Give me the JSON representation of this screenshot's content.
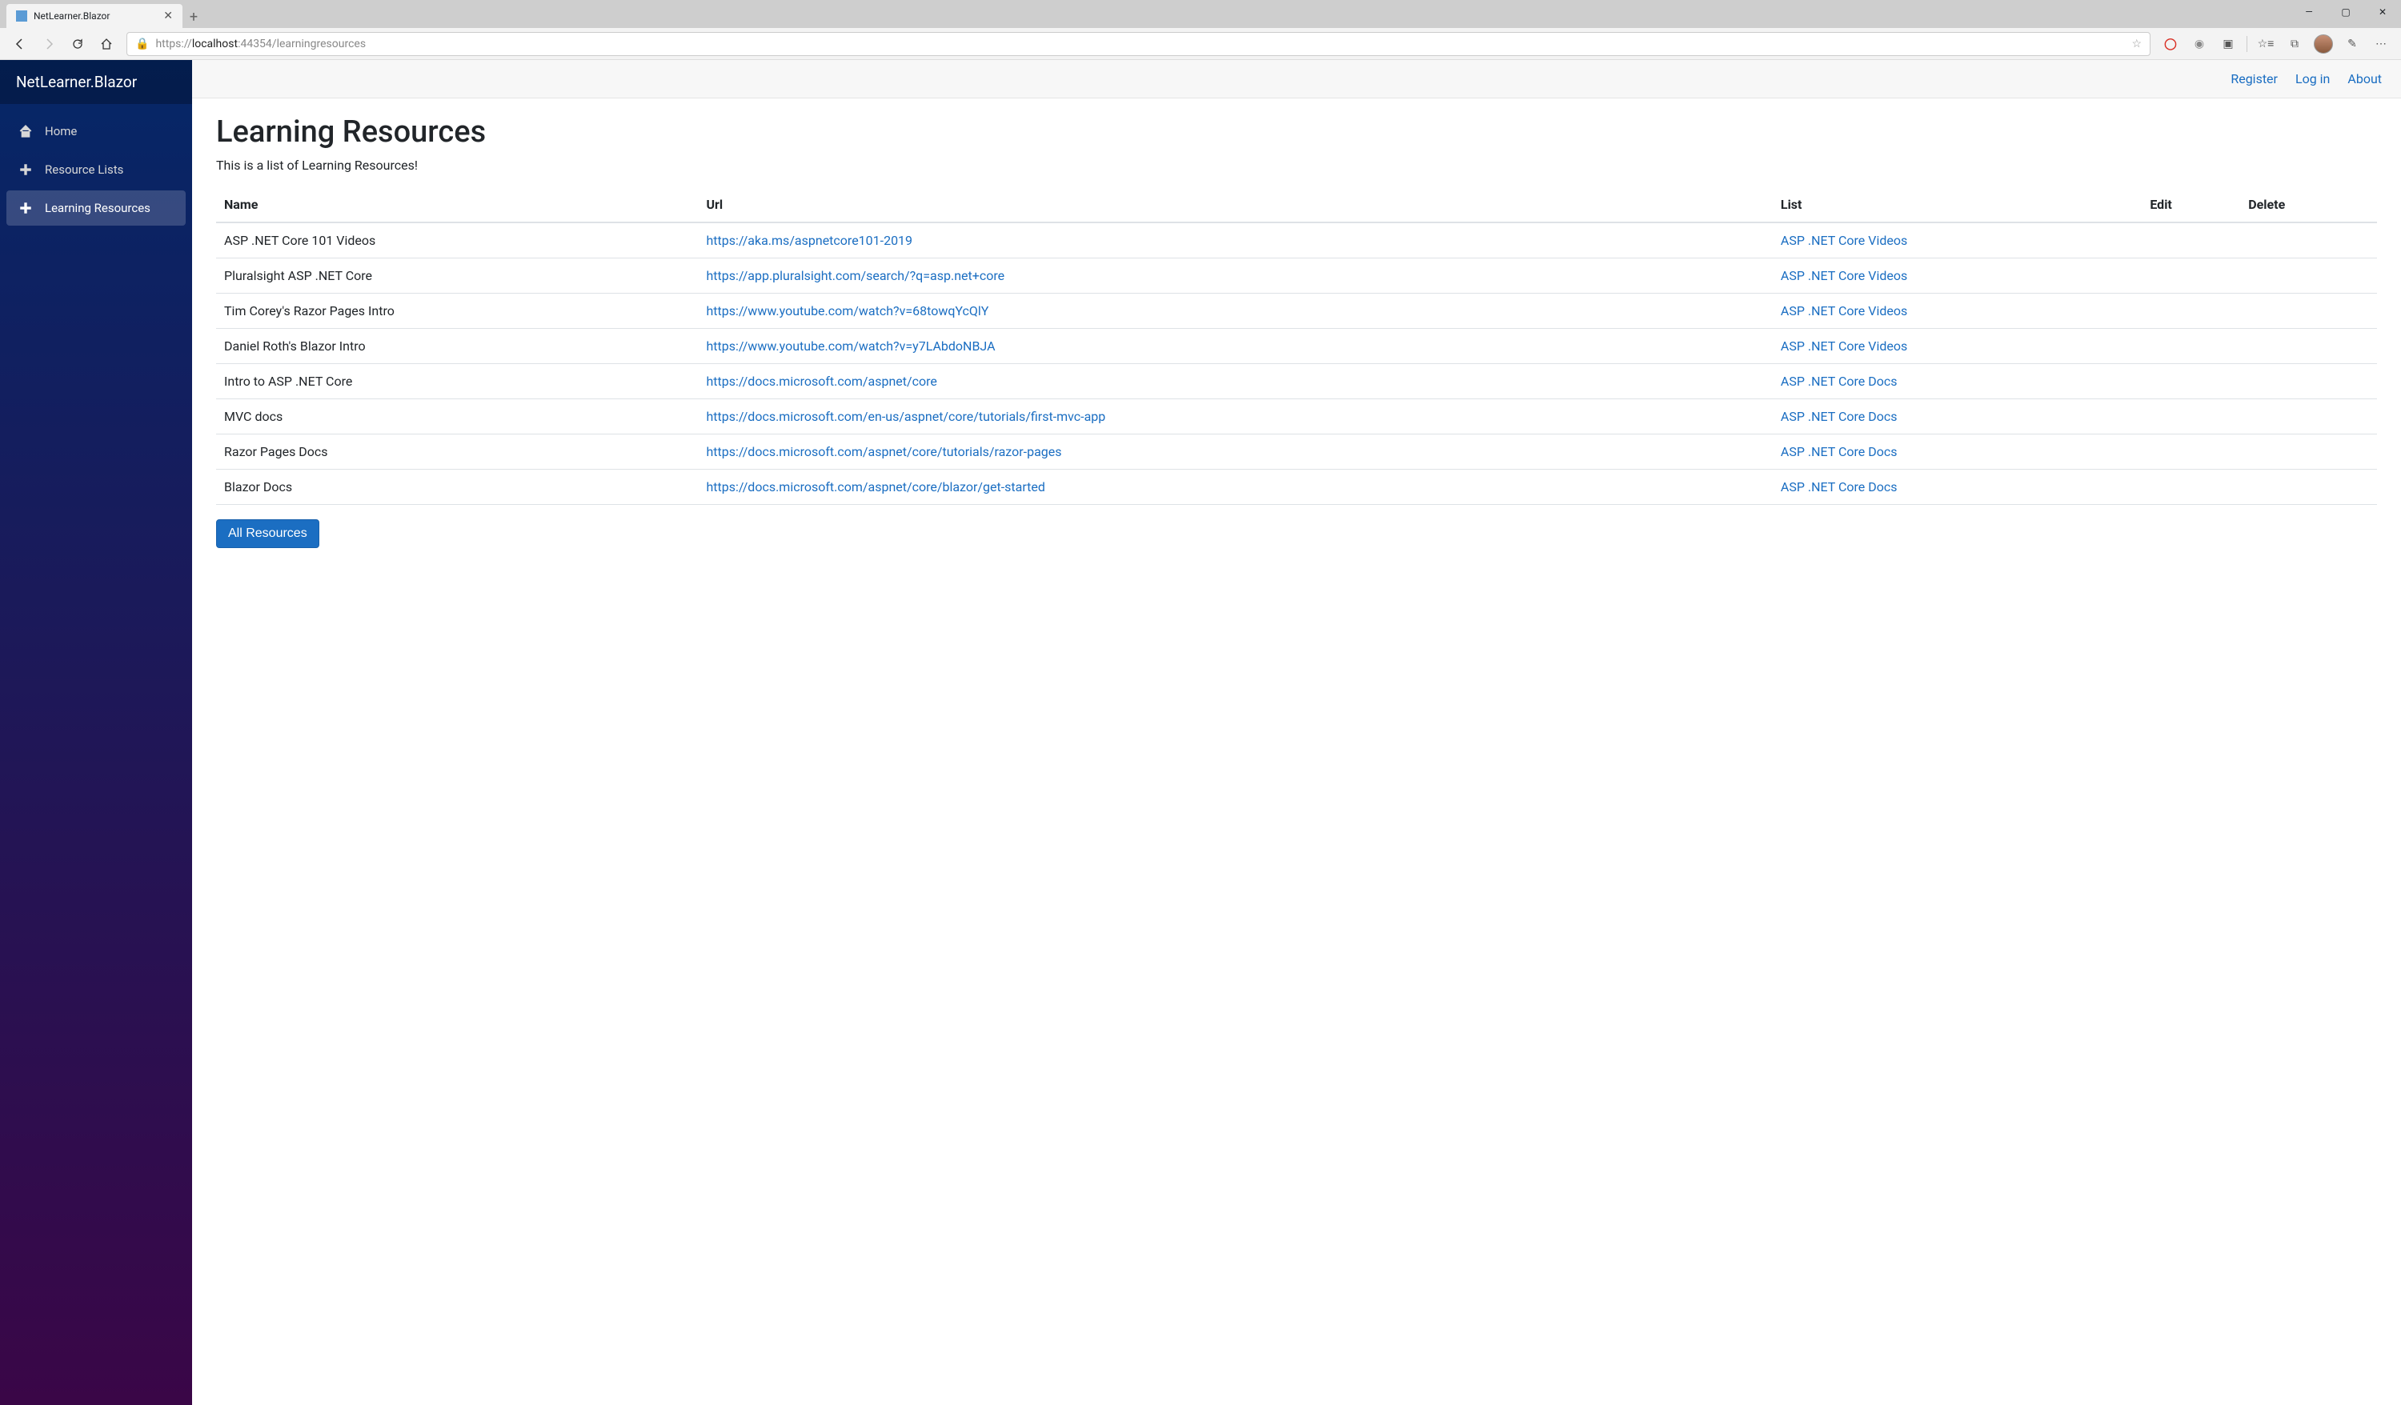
{
  "browser": {
    "tab_title": "NetLearner.Blazor",
    "url_prefix": "https://",
    "url_host": "localhost",
    "url_port": ":44354",
    "url_path": "/learningresources"
  },
  "sidebar": {
    "brand": "NetLearner.Blazor",
    "items": [
      {
        "label": "Home"
      },
      {
        "label": "Resource Lists"
      },
      {
        "label": "Learning Resources"
      }
    ]
  },
  "topbar": {
    "register": "Register",
    "login": "Log in",
    "about": "About"
  },
  "page": {
    "title": "Learning Resources",
    "subtitle": "This is a list of Learning Resources!",
    "columns": {
      "name": "Name",
      "url": "Url",
      "list": "List",
      "edit": "Edit",
      "delete": "Delete"
    },
    "rows": [
      {
        "name": "ASP .NET Core 101 Videos",
        "url": "https://aka.ms/aspnetcore101-2019",
        "list": "ASP .NET Core Videos"
      },
      {
        "name": "Pluralsight ASP .NET Core",
        "url": "https://app.pluralsight.com/search/?q=asp.net+core",
        "list": "ASP .NET Core Videos"
      },
      {
        "name": "Tim Corey's Razor Pages Intro",
        "url": "https://www.youtube.com/watch?v=68towqYcQlY",
        "list": "ASP .NET Core Videos"
      },
      {
        "name": "Daniel Roth's Blazor Intro",
        "url": "https://www.youtube.com/watch?v=y7LAbdoNBJA",
        "list": "ASP .NET Core Videos"
      },
      {
        "name": "Intro to ASP .NET Core",
        "url": "https://docs.microsoft.com/aspnet/core",
        "list": "ASP .NET Core Docs"
      },
      {
        "name": "MVC docs",
        "url": "https://docs.microsoft.com/en-us/aspnet/core/tutorials/first-mvc-app",
        "list": "ASP .NET Core Docs"
      },
      {
        "name": "Razor Pages Docs",
        "url": "https://docs.microsoft.com/aspnet/core/tutorials/razor-pages",
        "list": "ASP .NET Core Docs"
      },
      {
        "name": "Blazor Docs",
        "url": "https://docs.microsoft.com/aspnet/core/blazor/get-started",
        "list": "ASP .NET Core Docs"
      }
    ],
    "all_button": "All Resources"
  }
}
